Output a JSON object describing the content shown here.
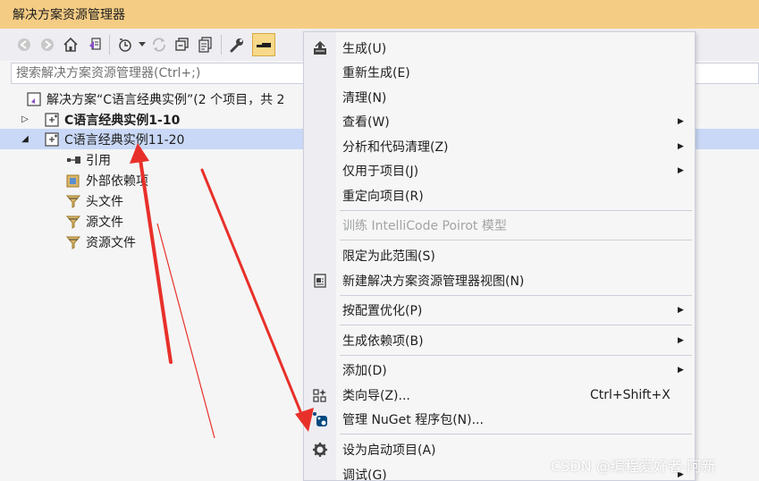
{
  "window": {
    "title": "解决方案资源管理器"
  },
  "search": {
    "placeholder": "搜索解决方案资源管理器(Ctrl+;)"
  },
  "tree": {
    "solution": "解决方案“C语言经典实例”(2 个项目，共 2",
    "project1": "C语言经典实例1-10",
    "project2": "C语言经典实例11-20",
    "children": [
      "引用",
      "外部依赖项",
      "头文件",
      "源文件",
      "资源文件"
    ]
  },
  "context_menu": {
    "build": "生成(U)",
    "rebuild": "重新生成(E)",
    "clean": "清理(N)",
    "view": "查看(W)",
    "analyze": "分析和代码清理(Z)",
    "project_only": "仅用于项目(J)",
    "retarget": "重定向项目(R)",
    "intellicode": "训练 IntelliCode Poirot 模型",
    "scope": "限定为此范围(S)",
    "new_view": "新建解决方案资源管理器视图(N)",
    "pgo": "按配置优化(P)",
    "build_deps": "生成依赖项(B)",
    "add": "添加(D)",
    "class_wizard": "类向导(Z)...",
    "class_wizard_shortcut": "Ctrl+Shift+X",
    "nuget": "管理 NuGet 程序包(N)...",
    "set_startup": "设为启动项目(A)",
    "debug": "调试(G)"
  },
  "watermark": "CSDN @编程爱好者-阿新",
  "colors": {
    "titlebar": "#f5cc84",
    "selection": "#c9d8f6",
    "arrow": "#e8302a",
    "active_tool": "#f8d98a"
  }
}
